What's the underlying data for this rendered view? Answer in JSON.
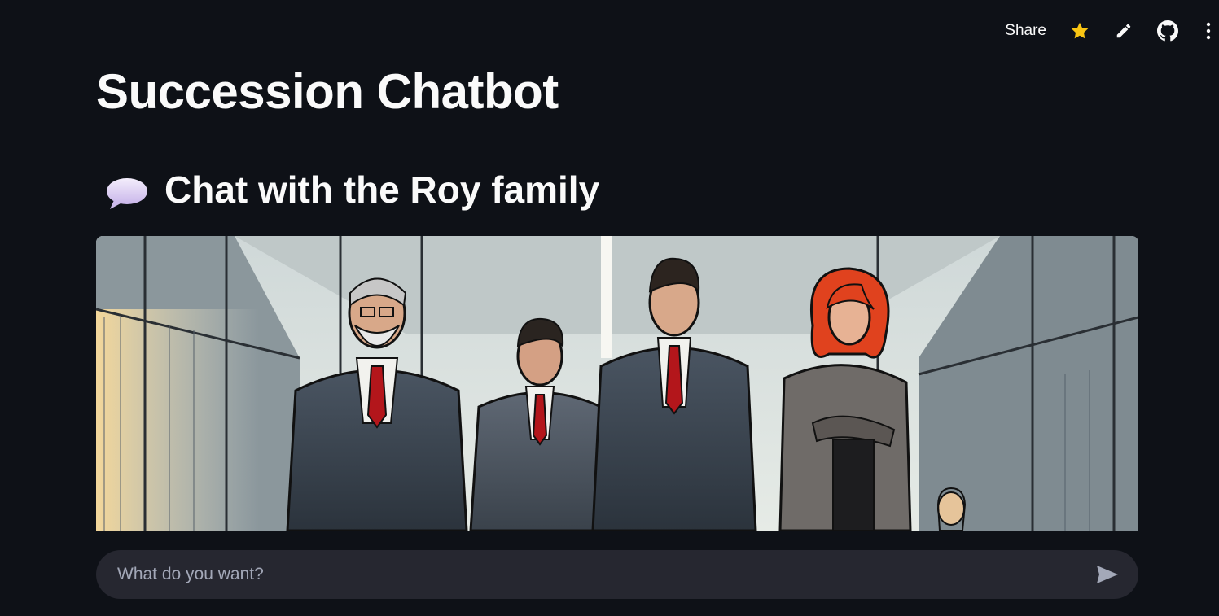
{
  "toolbar": {
    "share_label": "Share",
    "icons": [
      "star-icon",
      "pencil-icon",
      "github-icon",
      "more-vertical-icon"
    ],
    "star_color": "#f9c513"
  },
  "page": {
    "title": "Succession Chatbot",
    "subtitle": "Chat with the Roy family",
    "subtitle_icon": "speech-bubble-icon"
  },
  "hero": {
    "description": "comic-style illustration of four business people in suits walking in an office corridor"
  },
  "chat": {
    "placeholder": "What do you want?",
    "value": "",
    "send_icon": "send-icon"
  },
  "colors": {
    "background": "#0e1117",
    "input_background": "#262730",
    "text": "#fafafa",
    "placeholder": "#a3a8b8"
  }
}
